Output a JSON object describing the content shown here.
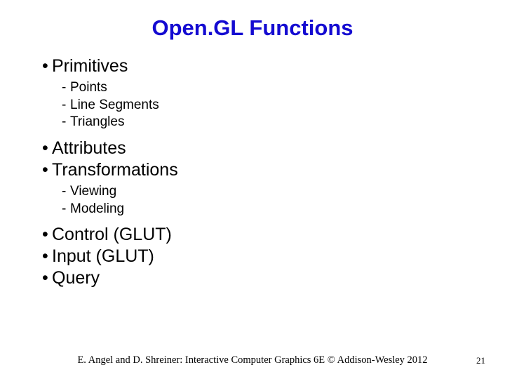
{
  "title": "Open.GL Functions",
  "bullets": {
    "b1": "Primitives",
    "b1_sub": {
      "s1": "Points",
      "s2": "Line Segments",
      "s3": "Triangles"
    },
    "b2": "Attributes",
    "b3": "Transformations",
    "b3_sub": {
      "s1": "Viewing",
      "s2": "Modeling"
    },
    "b4": "Control (GLUT)",
    "b5": "Input (GLUT)",
    "b6": "Query"
  },
  "footer": "E. Angel and D. Shreiner: Interactive Computer Graphics 6E © Addison-Wesley 2012",
  "page": "21",
  "glyphs": {
    "bullet": "•",
    "dash": "-"
  }
}
